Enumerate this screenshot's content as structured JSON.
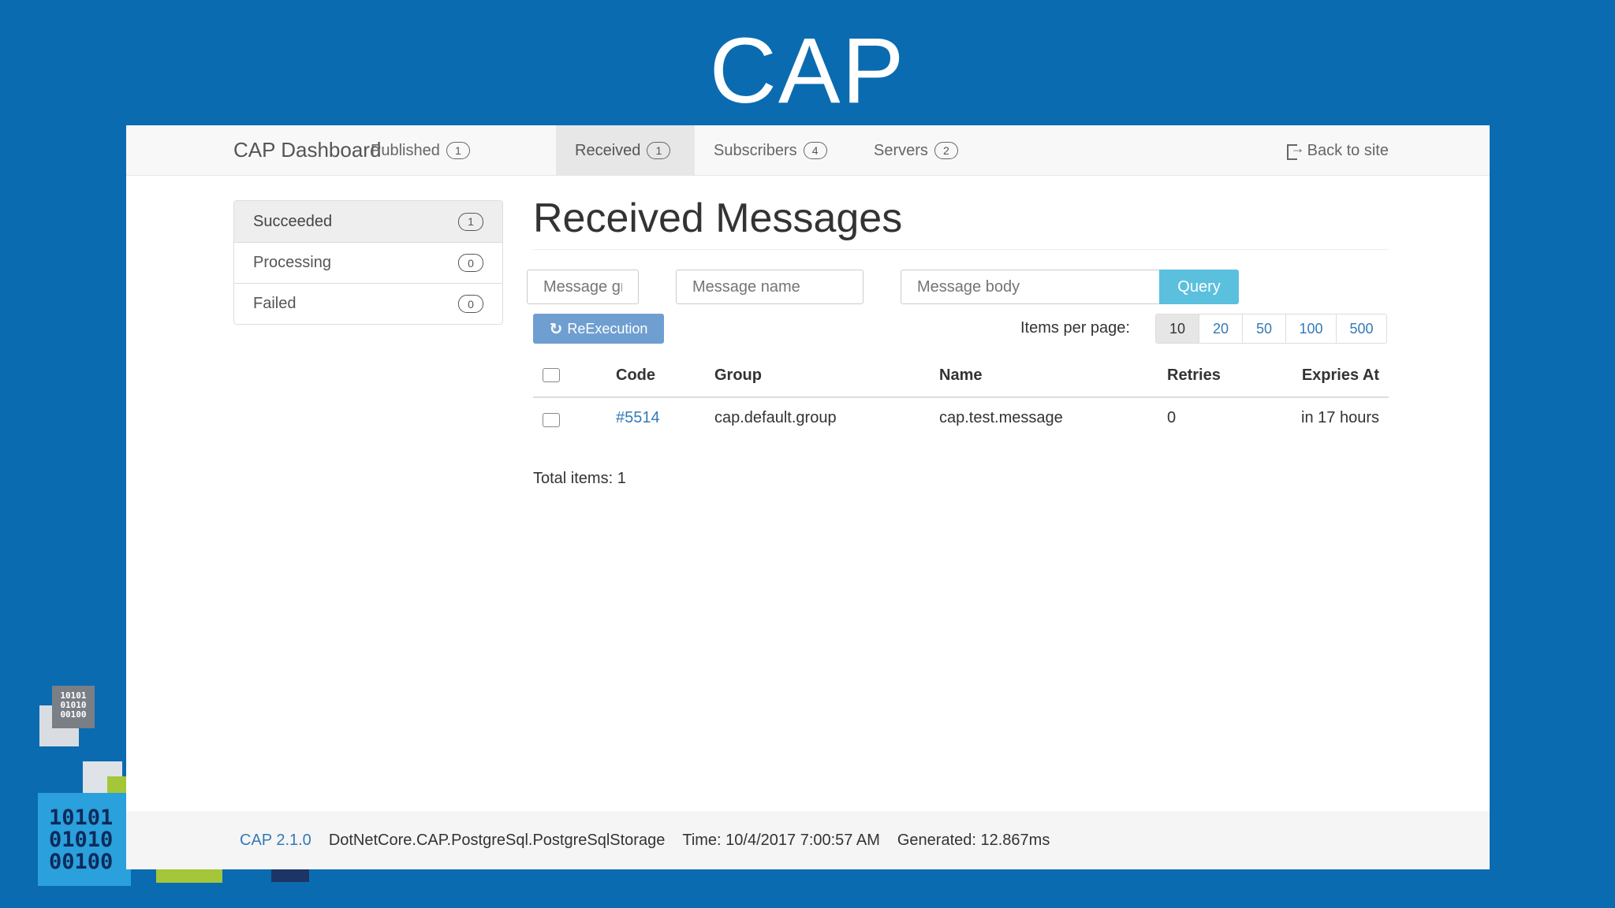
{
  "slide": {
    "title": "CAP",
    "deco_binary": [
      "10101",
      "01010",
      "00100"
    ]
  },
  "navbar": {
    "brand": "CAP Dashboard",
    "items": [
      {
        "label": "Published",
        "count": "1"
      },
      {
        "label": "Received",
        "count": "1"
      },
      {
        "label": "Subscribers",
        "count": "4"
      },
      {
        "label": "Servers",
        "count": "2"
      }
    ],
    "back": "Back to site"
  },
  "sidebar": {
    "items": [
      {
        "label": "Succeeded",
        "count": "1"
      },
      {
        "label": "Processing",
        "count": "0"
      },
      {
        "label": "Failed",
        "count": "0"
      }
    ]
  },
  "main": {
    "title": "Received Messages",
    "filters": {
      "group_placeholder": "Message group",
      "name_placeholder": "Message name",
      "body_placeholder": "Message body",
      "query": "Query"
    },
    "reexecute": "ReExecution",
    "items_per_page_label": "Items per page:",
    "page_sizes": [
      "10",
      "20",
      "50",
      "100",
      "500"
    ],
    "table": {
      "headers": [
        "Code",
        "Group",
        "Name",
        "Retries",
        "Expries At"
      ],
      "rows": [
        {
          "code": "#5514",
          "group": "cap.default.group",
          "name": "cap.test.message",
          "retries": "0",
          "expires": "in 17 hours"
        }
      ]
    },
    "total": "Total items: 1"
  },
  "footer": {
    "version": "CAP 2.1.0",
    "storage": "DotNetCore.CAP.PostgreSql.PostgreSqlStorage",
    "time": "Time: 10/4/2017 7:00:57 AM",
    "generated": "Generated: 12.867ms"
  },
  "colors": {
    "slide_bg": "#0a6bb1",
    "link": "#337ab7",
    "query_button": "#5bc0de",
    "reexecute_button": "#6f9ed1"
  }
}
